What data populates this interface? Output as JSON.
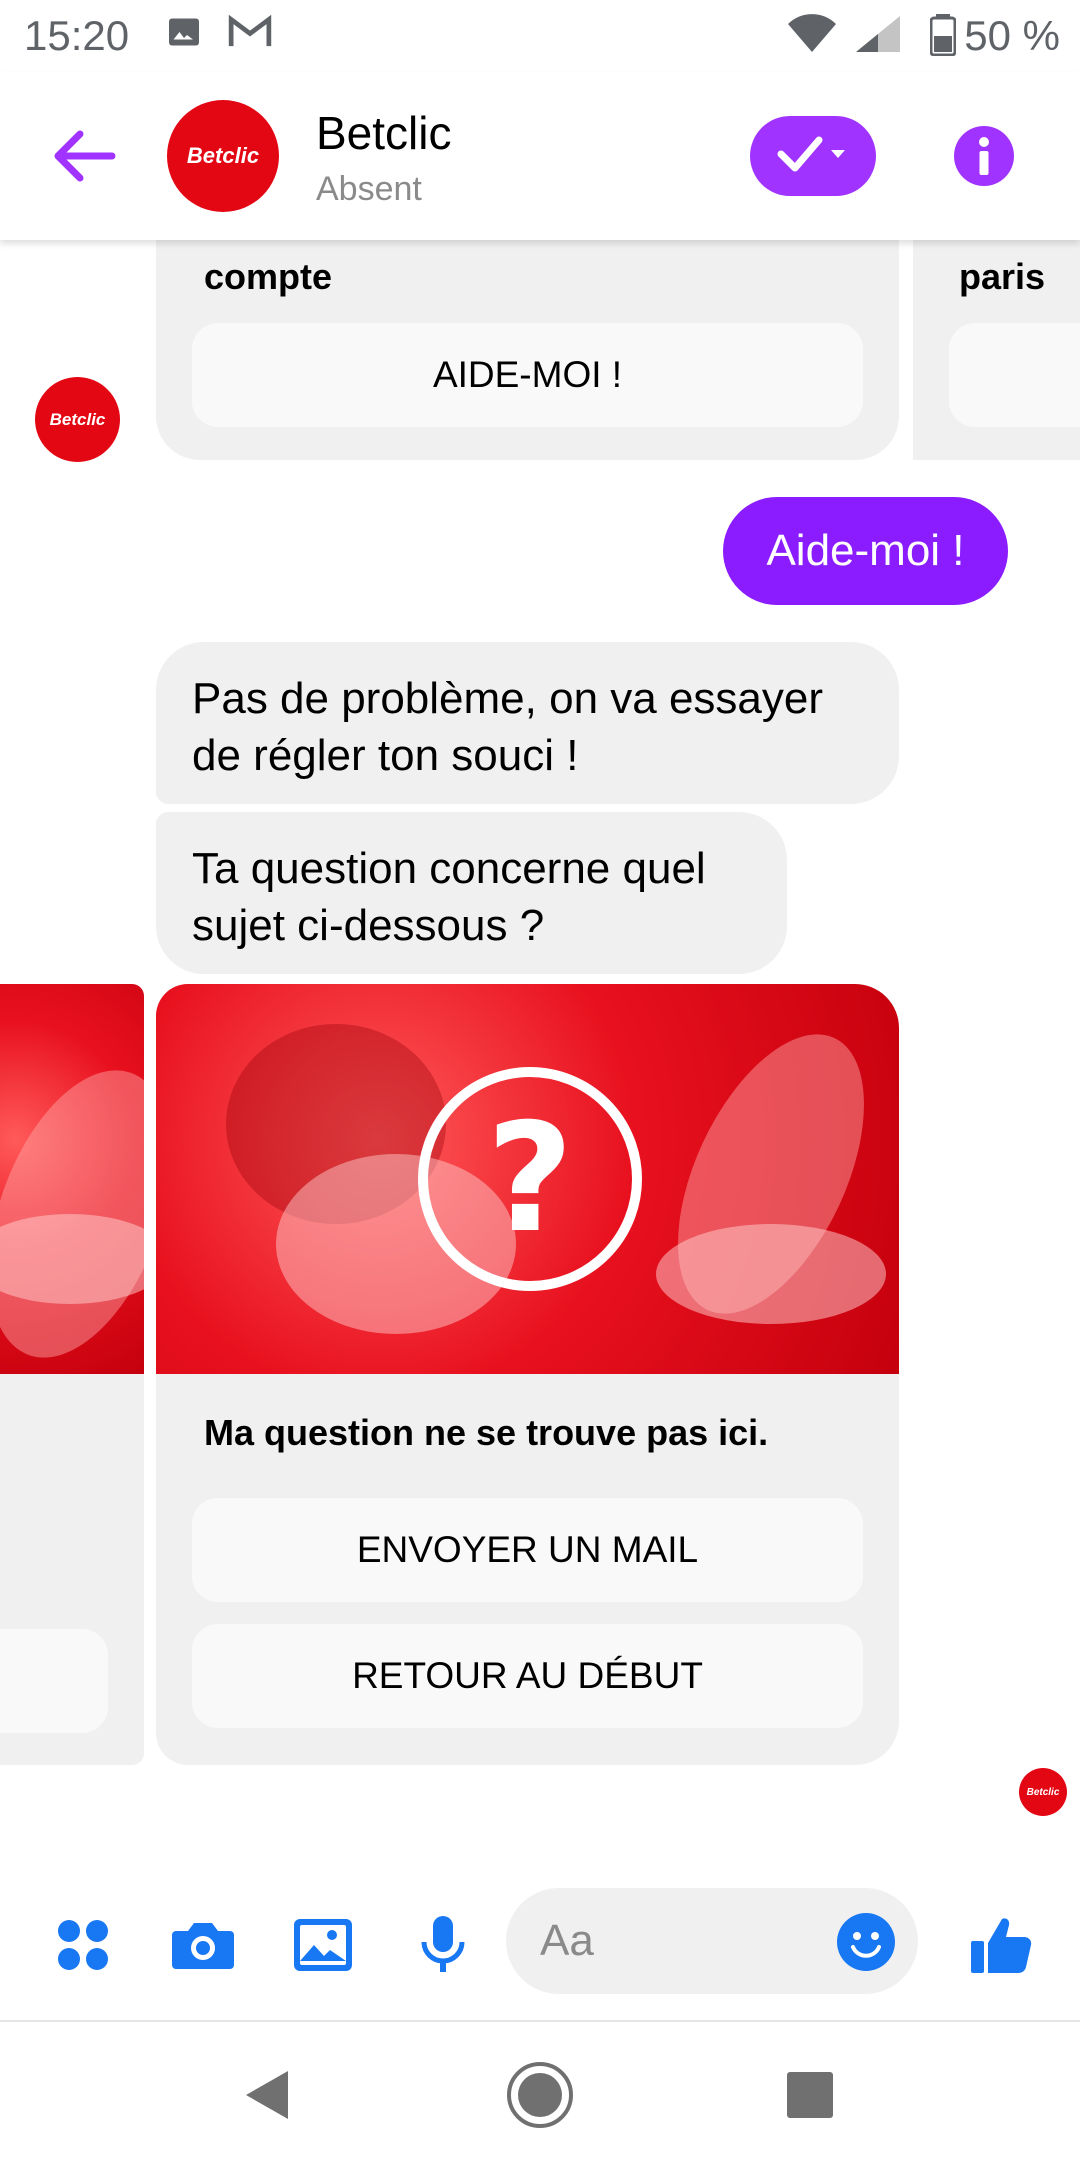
{
  "status_bar": {
    "time": "15:20",
    "battery_text": "50 %",
    "icons": [
      "image-icon",
      "gmail-icon",
      "wifi-icon",
      "signal-icon",
      "battery-icon"
    ]
  },
  "header": {
    "contact_name": "Betclic",
    "contact_status": "Absent",
    "avatar_logo": "Betclic",
    "icons": [
      "back-arrow-icon",
      "check-dropdown-icon",
      "info-icon"
    ]
  },
  "chat": {
    "top_card": {
      "title": "compte",
      "button_label": "AIDE-MOI !"
    },
    "top_card_next": {
      "title": "paris"
    },
    "bot_avatar_logo": "Betclic",
    "user_message": "Aide-moi !",
    "bot_messages": [
      "Pas de problème, on va essayer de régler ton souci !",
      "Ta question concerne quel sujet ci-dessous ?"
    ],
    "main_card": {
      "image_icon": "question-mark-icon",
      "image_glyph": "?",
      "title": "Ma question ne se trouve pas ici.",
      "buttons": [
        "ENVOYER UN MAIL",
        "RETOUR AU DÉBUT"
      ]
    },
    "read_receipt_logo": "Betclic"
  },
  "composer": {
    "placeholder": "Aa",
    "icons": [
      "more-apps-icon",
      "camera-icon",
      "gallery-icon",
      "microphone-icon",
      "emoji-icon",
      "thumbs-up-icon"
    ]
  },
  "navbar": {
    "icons": [
      "back-nav-icon",
      "home-nav-icon",
      "recents-nav-icon"
    ]
  },
  "colors": {
    "accent_purple": "#a033ff",
    "user_bubble": "#8a1cff",
    "brand_red": "#e30613",
    "composer_blue": "#1877f2",
    "bubble_gray": "#f0f0f0"
  }
}
